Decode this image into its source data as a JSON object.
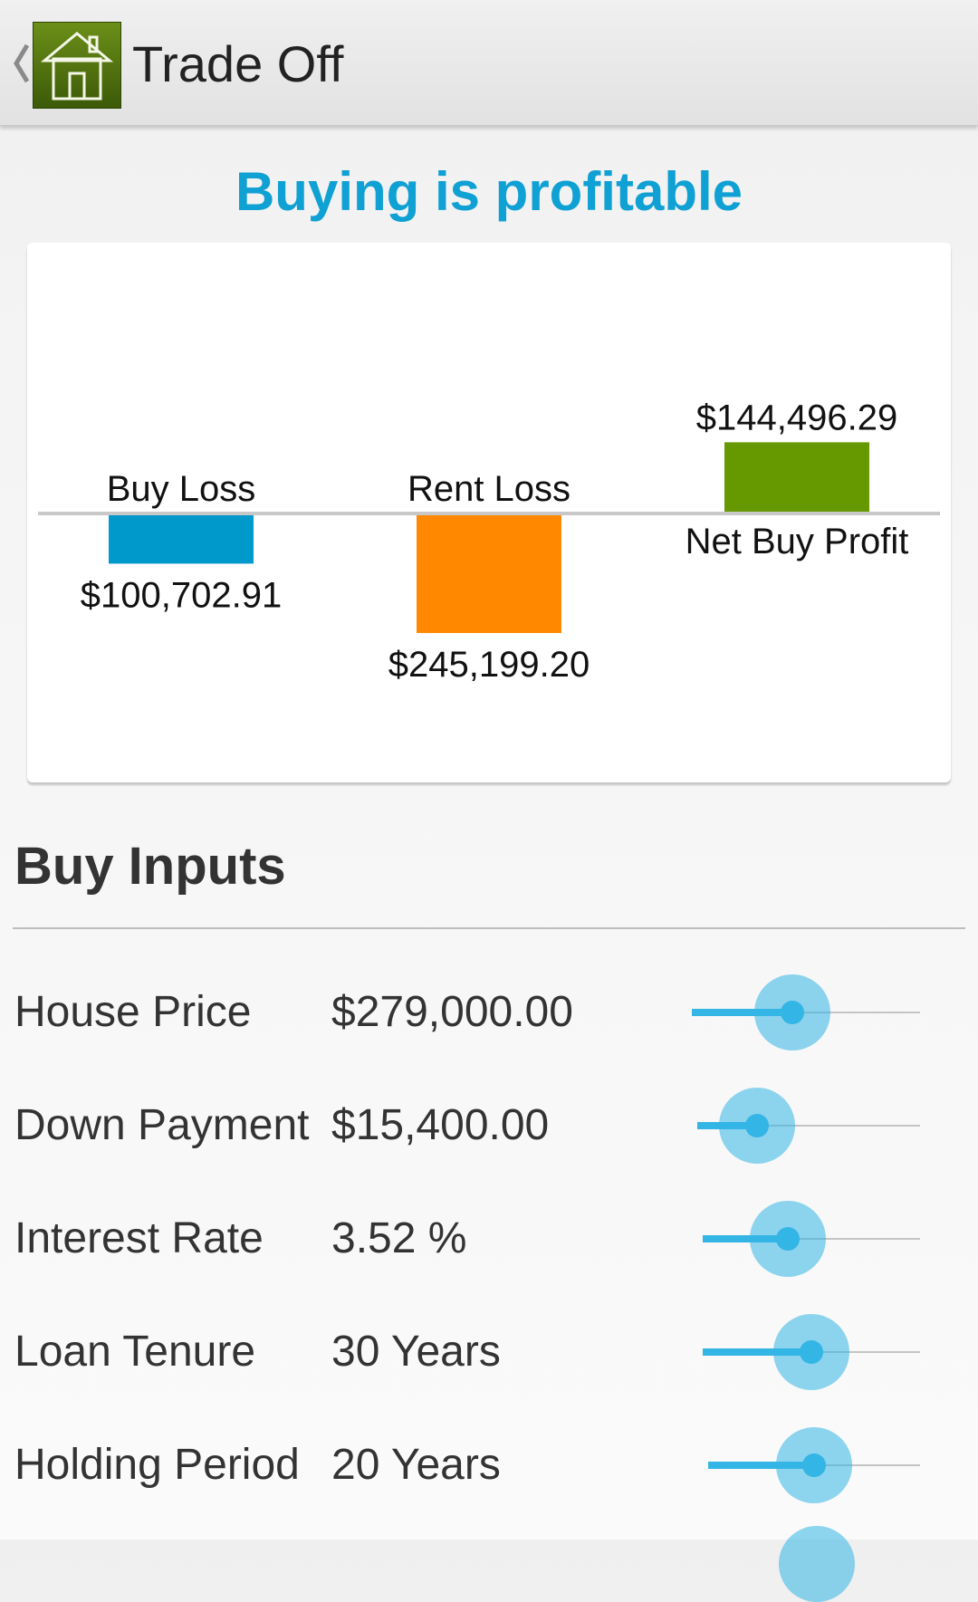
{
  "app": {
    "title": "Trade Off",
    "icon": "house-icon"
  },
  "headline": "Buying is profitable",
  "colors": {
    "accent": "#0fa0d4",
    "buy_loss": "#0099cc",
    "rent_loss": "#ff8800",
    "net_buy_profit": "#669900",
    "slider": "#33b5e5"
  },
  "chart_data": {
    "type": "bar",
    "categories": [
      "Buy Loss",
      "Rent Loss",
      "Net Buy Profit"
    ],
    "values": [
      -100702.91,
      -245199.2,
      144496.29
    ],
    "value_labels": [
      "$100,702.91",
      "$245,199.20",
      "$144,496.29"
    ],
    "colors": [
      "#0099cc",
      "#ff8800",
      "#669900"
    ],
    "title": "",
    "xlabel": "",
    "ylabel": "",
    "grid": false,
    "legend": "none",
    "baseline_value": 0
  },
  "buy_inputs": {
    "title": "Buy Inputs",
    "rows": [
      {
        "label": "House Price",
        "value": "$279,000.00",
        "slider_fraction": 0.44
      },
      {
        "label": "Down Payment",
        "value": "$15,400.00",
        "slider_fraction": 0.27
      },
      {
        "label": "Interest Rate",
        "value": "3.52 %",
        "slider_fraction": 0.39
      },
      {
        "label": "Loan Tenure",
        "value": "30 Years",
        "slider_fraction": 0.5
      },
      {
        "label": "Holding Period",
        "value": "20 Years",
        "slider_fraction": 0.5
      }
    ]
  }
}
